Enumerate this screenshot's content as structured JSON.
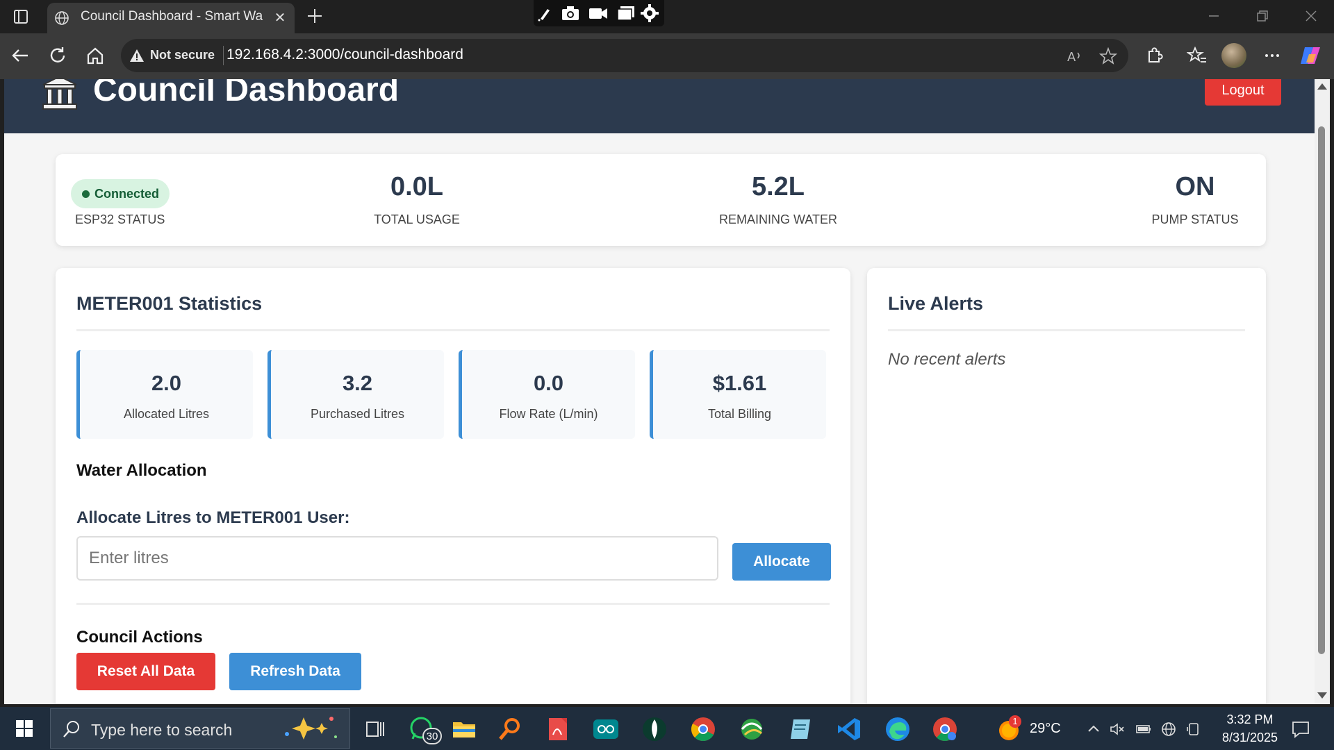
{
  "browser": {
    "tab_title": "Council Dashboard - Smart Water",
    "security_label": "Not secure",
    "url": "192.168.4.2:3000/council-dashboard"
  },
  "header": {
    "title": "Council Dashboard",
    "logout_label": "Logout"
  },
  "status": {
    "connection_badge": "Connected",
    "esp32_label": "ESP32 STATUS",
    "total_usage_value": "0.0L",
    "total_usage_label": "TOTAL USAGE",
    "remaining_value": "5.2L",
    "remaining_label": "REMAINING WATER",
    "pump_value": "ON",
    "pump_label": "PUMP STATUS"
  },
  "meter": {
    "title": "METER001 Statistics",
    "tiles": [
      {
        "value": "2.0",
        "label": "Allocated Litres"
      },
      {
        "value": "3.2",
        "label": "Purchased Litres"
      },
      {
        "value": "0.0",
        "label": "Flow Rate (L/min)"
      },
      {
        "value": "$1.61",
        "label": "Total Billing"
      }
    ],
    "allocation_heading": "Water Allocation",
    "allocation_label": "Allocate Litres to METER001 User:",
    "allocation_placeholder": "Enter litres",
    "allocate_button": "Allocate",
    "actions_heading": "Council Actions",
    "reset_button": "Reset All Data",
    "refresh_button": "Refresh Data"
  },
  "alerts": {
    "title": "Live Alerts",
    "empty_text": "No recent alerts"
  },
  "taskbar": {
    "search_placeholder": "Type here to search",
    "whatsapp_badge": "30",
    "weather_badge": "1",
    "temperature": "29°C",
    "time": "3:32 PM",
    "date": "8/31/2025"
  },
  "colors": {
    "header_bg": "#2c3a4e",
    "accent_blue": "#3d8fd6",
    "danger_red": "#e53935",
    "connected_green": "#d8f3e1"
  }
}
